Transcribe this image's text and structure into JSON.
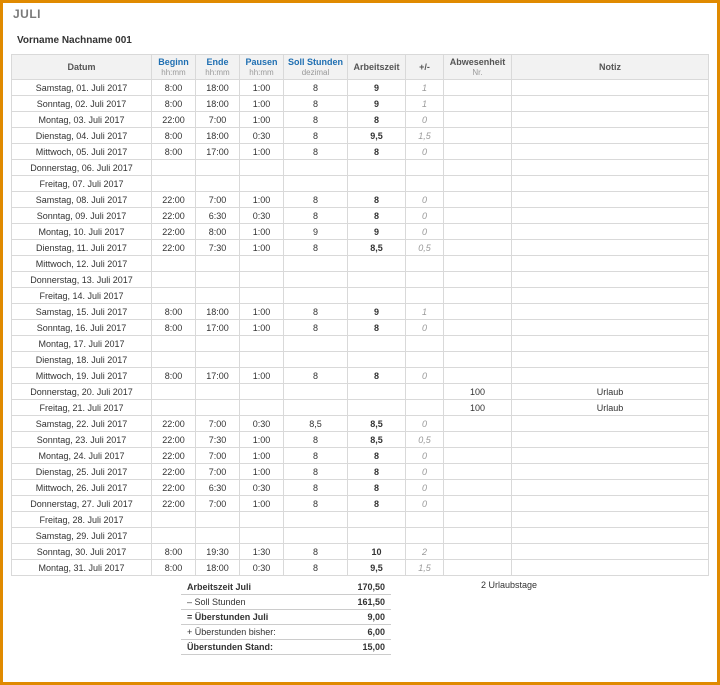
{
  "title": "JULI",
  "subhead": "Vorname Nachname   001",
  "headers": {
    "date": "Datum",
    "begin": "Beginn",
    "end": "Ende",
    "pause": "Pausen",
    "soll": "Soll Stunden",
    "arbeitszeit": "Arbeitszeit",
    "plusminus": "+/-",
    "abwesenheit": "Abwesenheit",
    "notiz": "Notiz",
    "sub_hhmm": "hh:mm",
    "sub_dez": "dezimal",
    "sub_nr": "Nr."
  },
  "rows": [
    {
      "date": "Samstag, 01. Juli 2017",
      "begin": "8:00",
      "end": "18:00",
      "pause": "1:00",
      "soll": "8",
      "az": "9",
      "pm": "1"
    },
    {
      "date": "Sonntag, 02. Juli 2017",
      "begin": "8:00",
      "end": "18:00",
      "pause": "1:00",
      "soll": "8",
      "az": "9",
      "pm": "1"
    },
    {
      "date": "Montag, 03. Juli 2017",
      "begin": "22:00",
      "end": "7:00",
      "pause": "1:00",
      "soll": "8",
      "az": "8",
      "pm": "0"
    },
    {
      "date": "Dienstag, 04. Juli 2017",
      "begin": "8:00",
      "end": "18:00",
      "pause": "0:30",
      "soll": "8",
      "az": "9,5",
      "pm": "1,5"
    },
    {
      "date": "Mittwoch, 05. Juli 2017",
      "begin": "8:00",
      "end": "17:00",
      "pause": "1:00",
      "soll": "8",
      "az": "8",
      "pm": "0"
    },
    {
      "date": "Donnerstag, 06. Juli 2017"
    },
    {
      "date": "Freitag, 07. Juli 2017"
    },
    {
      "date": "Samstag, 08. Juli 2017",
      "begin": "22:00",
      "end": "7:00",
      "pause": "1:00",
      "soll": "8",
      "az": "8",
      "pm": "0"
    },
    {
      "date": "Sonntag, 09. Juli 2017",
      "begin": "22:00",
      "end": "6:30",
      "pause": "0:30",
      "soll": "8",
      "az": "8",
      "pm": "0"
    },
    {
      "date": "Montag, 10. Juli 2017",
      "begin": "22:00",
      "end": "8:00",
      "pause": "1:00",
      "soll": "9",
      "az": "9",
      "pm": "0"
    },
    {
      "date": "Dienstag, 11. Juli 2017",
      "begin": "22:00",
      "end": "7:30",
      "pause": "1:00",
      "soll": "8",
      "az": "8,5",
      "pm": "0,5"
    },
    {
      "date": "Mittwoch, 12. Juli 2017"
    },
    {
      "date": "Donnerstag, 13. Juli 2017"
    },
    {
      "date": "Freitag, 14. Juli 2017"
    },
    {
      "date": "Samstag, 15. Juli 2017",
      "begin": "8:00",
      "end": "18:00",
      "pause": "1:00",
      "soll": "8",
      "az": "9",
      "pm": "1"
    },
    {
      "date": "Sonntag, 16. Juli 2017",
      "begin": "8:00",
      "end": "17:00",
      "pause": "1:00",
      "soll": "8",
      "az": "8",
      "pm": "0"
    },
    {
      "date": "Montag, 17. Juli 2017"
    },
    {
      "date": "Dienstag, 18. Juli 2017"
    },
    {
      "date": "Mittwoch, 19. Juli 2017",
      "begin": "8:00",
      "end": "17:00",
      "pause": "1:00",
      "soll": "8",
      "az": "8",
      "pm": "0"
    },
    {
      "date": "Donnerstag, 20. Juli 2017",
      "abw": "100",
      "notiz": "Urlaub"
    },
    {
      "date": "Freitag, 21. Juli 2017",
      "abw": "100",
      "notiz": "Urlaub"
    },
    {
      "date": "Samstag, 22. Juli 2017",
      "begin": "22:00",
      "end": "7:00",
      "pause": "0:30",
      "soll": "8,5",
      "az": "8,5",
      "pm": "0"
    },
    {
      "date": "Sonntag, 23. Juli 2017",
      "begin": "22:00",
      "end": "7:30",
      "pause": "1:00",
      "soll": "8",
      "az": "8,5",
      "pm": "0,5"
    },
    {
      "date": "Montag, 24. Juli 2017",
      "begin": "22:00",
      "end": "7:00",
      "pause": "1:00",
      "soll": "8",
      "az": "8",
      "pm": "0"
    },
    {
      "date": "Dienstag, 25. Juli 2017",
      "begin": "22:00",
      "end": "7:00",
      "pause": "1:00",
      "soll": "8",
      "az": "8",
      "pm": "0"
    },
    {
      "date": "Mittwoch, 26. Juli 2017",
      "begin": "22:00",
      "end": "6:30",
      "pause": "0:30",
      "soll": "8",
      "az": "8",
      "pm": "0"
    },
    {
      "date": "Donnerstag, 27. Juli 2017",
      "begin": "22:00",
      "end": "7:00",
      "pause": "1:00",
      "soll": "8",
      "az": "8",
      "pm": "0"
    },
    {
      "date": "Freitag, 28. Juli 2017"
    },
    {
      "date": "Samstag, 29. Juli 2017"
    },
    {
      "date": "Sonntag, 30. Juli 2017",
      "begin": "8:00",
      "end": "19:30",
      "pause": "1:30",
      "soll": "8",
      "az": "10",
      "pm": "2"
    },
    {
      "date": "Montag, 31. Juli 2017",
      "begin": "8:00",
      "end": "18:00",
      "pause": "0:30",
      "soll": "8",
      "az": "9,5",
      "pm": "1,5"
    }
  ],
  "vacation_note": "2 Urlaubstage",
  "summary": {
    "arbeitszeit_label": "Arbeitszeit Juli",
    "arbeitszeit_value": "170,50",
    "soll_label": "– Soll Stunden",
    "soll_value": "161,50",
    "ueber_label": "= Überstunden Juli",
    "ueber_value": "9,00",
    "bisher_label": "+ Überstunden bisher:",
    "bisher_value": "6,00",
    "stand_label": "Überstunden Stand:",
    "stand_value": "15,00"
  }
}
